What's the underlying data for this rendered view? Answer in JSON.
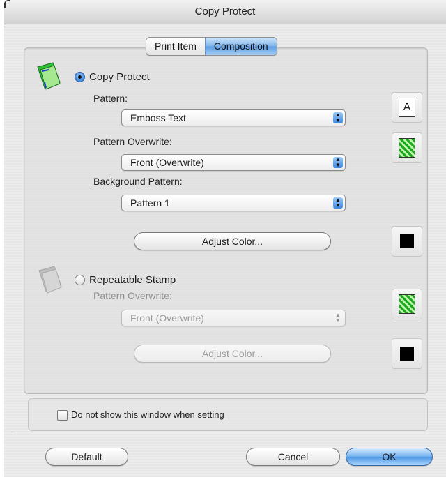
{
  "window": {
    "title": "Copy Protect"
  },
  "tabs": [
    {
      "label": "Print Item",
      "selected": false
    },
    {
      "label": "Composition",
      "selected": true
    }
  ],
  "copy_protect": {
    "label": "Copy Protect",
    "selected": true,
    "pattern": {
      "label": "Pattern:",
      "value": "Emboss Text"
    },
    "pattern_overwrite": {
      "label": "Pattern Overwrite:",
      "value": "Front (Overwrite)"
    },
    "background_pattern": {
      "label": "Background Pattern:",
      "value": "Pattern 1"
    },
    "adjust_color_label": "Adjust Color...",
    "sample_a_glyph": "A"
  },
  "repeatable_stamp": {
    "label": "Repeatable Stamp",
    "selected": false,
    "enabled": false,
    "pattern_overwrite": {
      "label": "Pattern Overwrite:",
      "value": "Front (Overwrite)"
    },
    "adjust_color_label": "Adjust Color..."
  },
  "options": {
    "dont_show_label": "Do not show this window when setting",
    "dont_show_checked": false
  },
  "buttons": {
    "default": "Default",
    "cancel": "Cancel",
    "ok": "OK"
  },
  "colors": {
    "accent": "#4d96e3",
    "pattern_green": "#19a81f",
    "swatch": "#000000"
  }
}
